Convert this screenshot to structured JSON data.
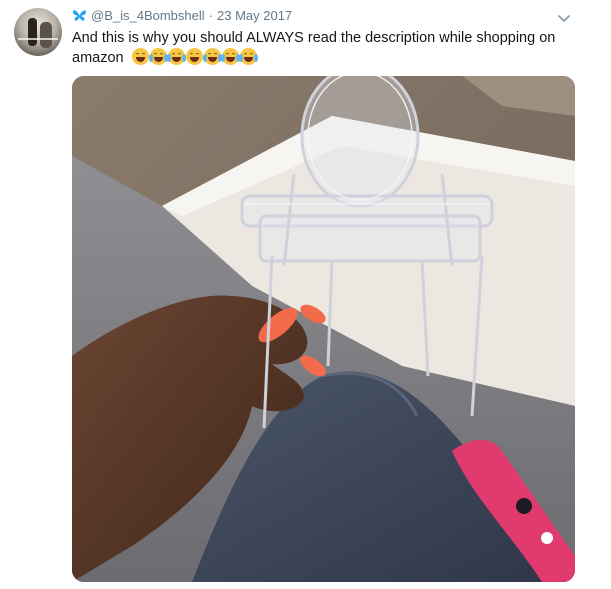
{
  "tweet": {
    "handle": "@B_is_4Bombshell",
    "separator": "·",
    "date": "23 May 2017",
    "text": "And this is why you should ALWAYS read the description while shopping on amazon",
    "emojis": [
      "weary-face",
      "tears-of-joy-face",
      "tears-of-joy-face",
      "weary-face",
      "tears-of-joy-face",
      "tears-of-joy-face",
      "tears-of-joy-face"
    ],
    "header_icon": "butterfly-icon",
    "menu_icon": "chevron-down-icon"
  },
  "colors": {
    "text": "#14171a",
    "meta": "#657786",
    "butterfly": "#1da1f2",
    "nail_polish": "#f26b4a"
  }
}
